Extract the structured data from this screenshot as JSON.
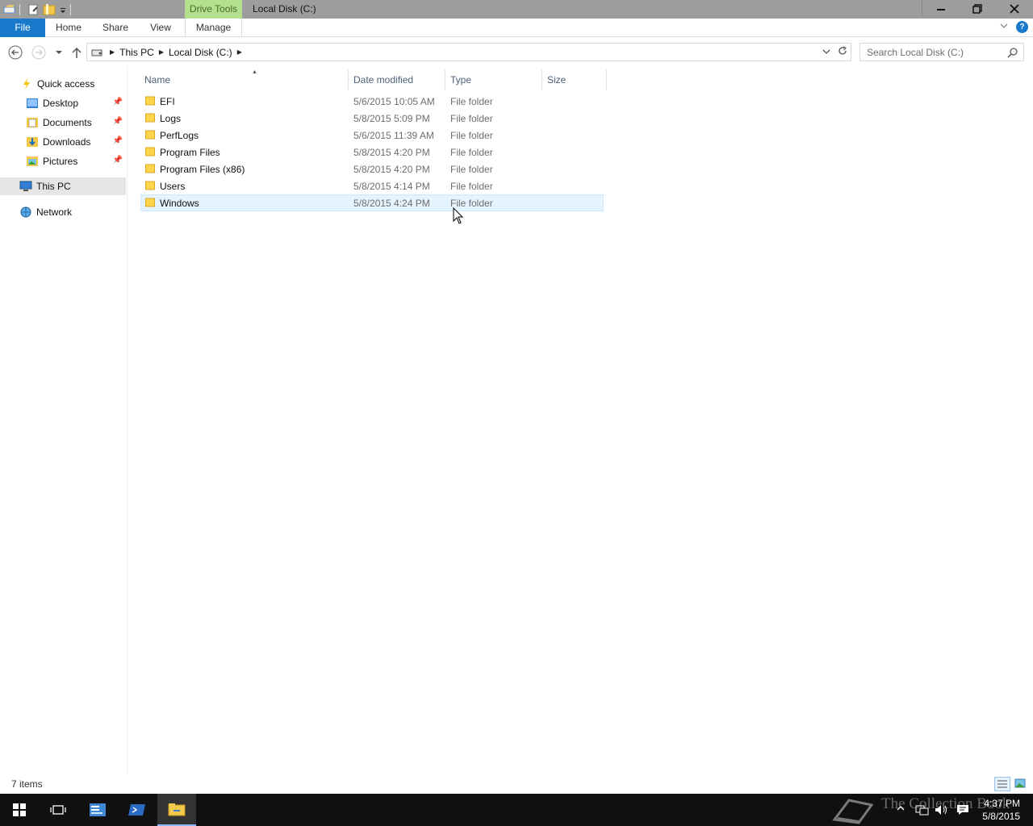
{
  "titlebar": {
    "context_tab": "Drive Tools",
    "title": "Local Disk (C:)",
    "buttons": {
      "minimize": "—",
      "restore": "❐",
      "close": "✕"
    }
  },
  "ribbon": {
    "tabs": [
      "File",
      "Home",
      "Share",
      "View",
      "Manage"
    ],
    "help": "?"
  },
  "address": {
    "crumbs": [
      "This PC",
      "Local Disk (C:)"
    ],
    "search_placeholder": "Search Local Disk (C:)"
  },
  "navpane": {
    "quick_access": "Quick access",
    "pinned": [
      "Desktop",
      "Documents",
      "Downloads",
      "Pictures"
    ],
    "this_pc": "This PC",
    "network": "Network"
  },
  "columns": [
    "Name",
    "Date modified",
    "Type",
    "Size"
  ],
  "files": [
    {
      "name": "EFI",
      "date": "5/6/2015 10:05 AM",
      "type": "File folder"
    },
    {
      "name": "Logs",
      "date": "5/8/2015 5:09 PM",
      "type": "File folder"
    },
    {
      "name": "PerfLogs",
      "date": "5/6/2015 11:39 AM",
      "type": "File folder"
    },
    {
      "name": "Program Files",
      "date": "5/8/2015 4:20 PM",
      "type": "File folder"
    },
    {
      "name": "Program Files (x86)",
      "date": "5/8/2015 4:20 PM",
      "type": "File folder"
    },
    {
      "name": "Users",
      "date": "5/8/2015 4:14 PM",
      "type": "File folder"
    },
    {
      "name": "Windows",
      "date": "5/8/2015 4:24 PM",
      "type": "File folder"
    }
  ],
  "status": {
    "item_count": "7 items"
  },
  "taskbar": {
    "time": "4:37 PM",
    "date": "5/8/2015",
    "watermark": "The Collection Book"
  },
  "colors": {
    "accent": "#1979ca",
    "context_tab": "#b3e08c",
    "hover_row": "#e5f3ff",
    "folder": "#ffd54a"
  }
}
